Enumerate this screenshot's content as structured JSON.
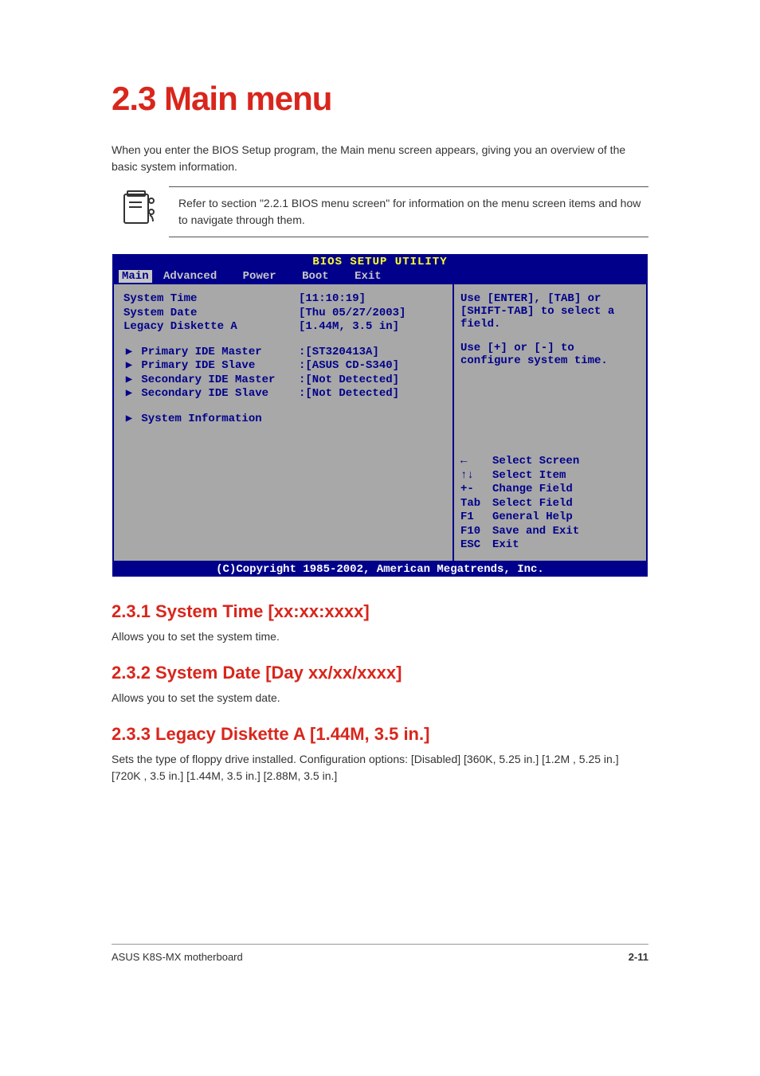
{
  "heading": "2.3    Main menu",
  "intro": "When you enter the BIOS Setup program, the Main menu screen appears, giving you an overview of the basic system information.",
  "note": "Refer to section \"2.2.1 BIOS menu screen\" for information on the menu screen items and how to navigate through them.",
  "bios": {
    "title": "BIOS SETUP UTILITY",
    "menubar": [
      "Main",
      "Advanced",
      "Power",
      "Boot",
      "Exit"
    ],
    "active_tab": "Main",
    "left": {
      "rows": [
        {
          "label": "System Time",
          "value": "[11:10:19]"
        },
        {
          "label": "System Date",
          "value": "[Thu 05/27/2003]"
        },
        {
          "label": "Legacy Diskette A",
          "value": "[1.44M, 3.5 in]"
        }
      ],
      "sub_rows": [
        {
          "label": "Primary IDE Master",
          "value": ":[ST320413A]"
        },
        {
          "label": "Primary IDE Slave",
          "value": ":[ASUS CD-S340]"
        },
        {
          "label": "Secondary IDE Master",
          "value": ":[Not Detected]"
        },
        {
          "label": "Secondary IDE Slave",
          "value": ":[Not Detected]"
        }
      ],
      "info_row": "System Information"
    },
    "right": {
      "help1": "Use [ENTER], [TAB] or [SHIFT-TAB] to select a field.",
      "help2": "Use [+] or [-] to configure system time.",
      "nav": [
        {
          "key": "←",
          "desc": "Select Screen"
        },
        {
          "key": "↑↓",
          "desc": "Select Item"
        },
        {
          "key": "+-",
          "desc": "Change Field"
        },
        {
          "key": "Tab",
          "desc": "Select Field"
        },
        {
          "key": "F1",
          "desc": "General Help"
        },
        {
          "key": "F10",
          "desc": "Save and Exit"
        },
        {
          "key": "ESC",
          "desc": "Exit"
        }
      ]
    },
    "footer": "(C)Copyright 1985-2002, American Megatrends, Inc."
  },
  "sections": [
    {
      "title": "2.3.1  System Time [xx:xx:xxxx]",
      "body": "Allows you to set the system time."
    },
    {
      "title": "2.3.2  System Date [Day xx/xx/xxxx]",
      "body": "Allows you to set the system date."
    },
    {
      "title": "2.3.3  Legacy Diskette A [1.44M, 3.5 in.]",
      "body": "Sets the type of floppy drive installed. Configuration options: [Disabled] [360K, 5.25 in.] [1.2M , 5.25 in.] [720K , 3.5 in.] [1.44M, 3.5 in.] [2.88M, 3.5 in.]"
    }
  ],
  "footer": {
    "left": "ASUS K8S-MX motherboard",
    "right": "2-11"
  }
}
